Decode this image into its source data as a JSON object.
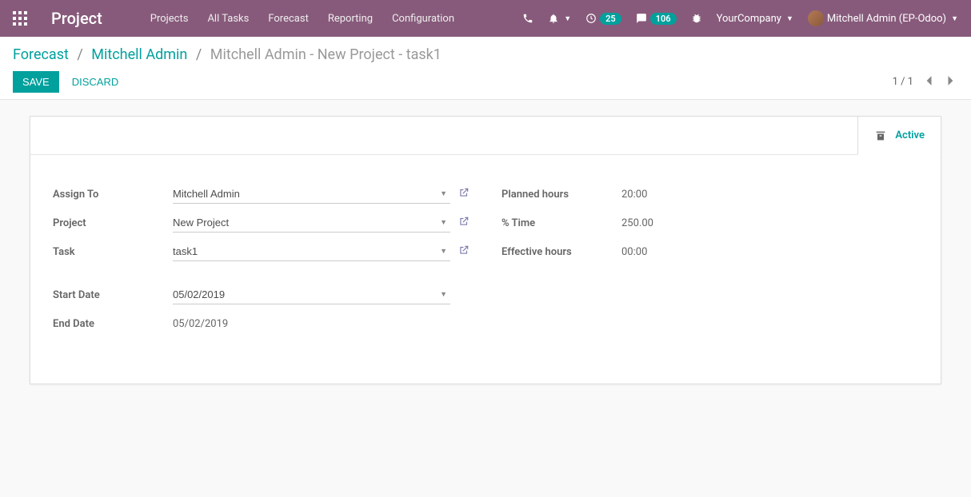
{
  "navbar": {
    "brand": "Project",
    "menu": [
      "Projects",
      "All Tasks",
      "Forecast",
      "Reporting",
      "Configuration"
    ],
    "badges": {
      "activities": "25",
      "messages": "106"
    },
    "company": "YourCompany",
    "user": "Mitchell Admin (EP-Odoo)"
  },
  "breadcrumb": {
    "root": "Forecast",
    "mid": "Mitchell Admin",
    "current": "Mitchell Admin - New Project - task1"
  },
  "buttons": {
    "save": "Save",
    "discard": "Discard",
    "active": "Active"
  },
  "pager": {
    "text": "1 / 1"
  },
  "form": {
    "labels": {
      "assign_to": "Assign To",
      "project": "Project",
      "task": "Task",
      "start_date": "Start Date",
      "end_date": "End Date",
      "planned_hours": "Planned hours",
      "percent_time": "% Time",
      "effective_hours": "Effective hours"
    },
    "values": {
      "assign_to": "Mitchell Admin",
      "project": "New Project",
      "task": "task1",
      "start_date": "05/02/2019",
      "end_date": "05/02/2019",
      "planned_hours": "20:00",
      "percent_time": "250.00",
      "effective_hours": "00:00"
    }
  }
}
